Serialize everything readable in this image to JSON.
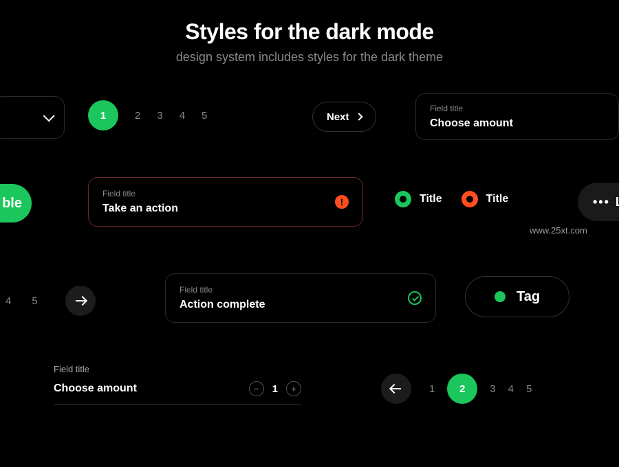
{
  "header": {
    "title": "Styles for the dark mode",
    "subtitle": "design system includes styles for the dark theme"
  },
  "row1": {
    "pages": [
      "1",
      "2",
      "3",
      "4",
      "5"
    ],
    "active_index": 0,
    "next_label": "Next",
    "field_label": "Field title",
    "field_value": "Choose amount"
  },
  "row2": {
    "button_partial": "ble",
    "field_label": "Field title",
    "field_value": "Take an action",
    "warn_glyph": "!",
    "radio1_label": "Title",
    "radio2_label": "Title",
    "dark_btn_dots": "•••",
    "dark_btn_letter": "L",
    "watermark": "www.25xt.com"
  },
  "row3": {
    "mini_pages": [
      "4",
      "5"
    ],
    "field_label": "Field title",
    "field_value": "Action complete",
    "tag_label": "Tag"
  },
  "row4": {
    "field_label": "Field title",
    "field_value": "Choose amount",
    "stepper_minus": "−",
    "stepper_value": "1",
    "stepper_plus": "+",
    "pages": [
      "1",
      "2",
      "3",
      "4",
      "5"
    ],
    "active_index": 1
  }
}
